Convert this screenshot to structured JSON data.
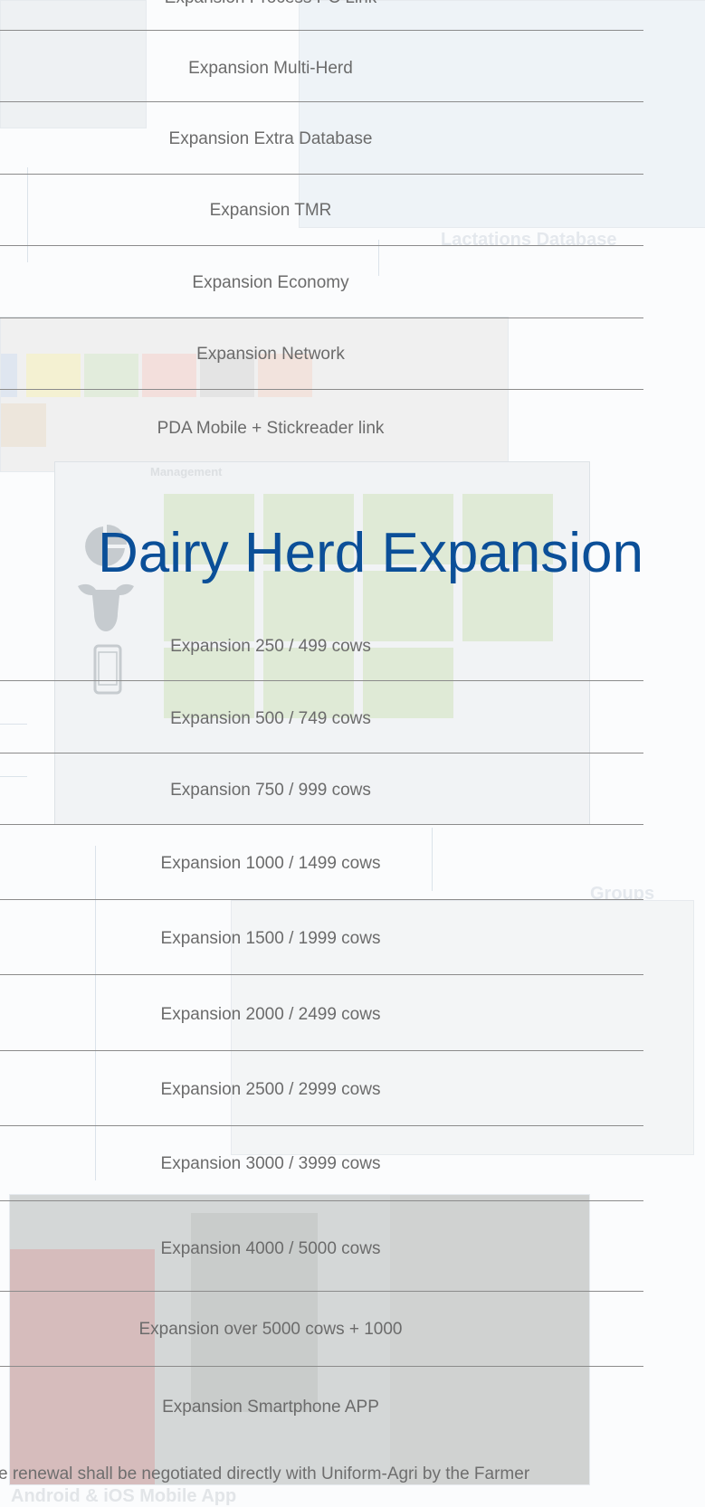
{
  "colors": {
    "accent": "#0b4f98",
    "text": "#6b6b6b",
    "divider": "#8b8b8b"
  },
  "icons": [
    "pie-chart-icon",
    "cow-icon",
    "smartphone-icon"
  ],
  "background_text": {
    "lactations": "Lactations Database",
    "groups": "Groups",
    "mobile": "Android & iOS Mobile App",
    "management": "Management"
  },
  "options_top": [
    "Expansion Process PC Link",
    "Expansion Multi-Herd",
    "Expansion Extra Database",
    "Expansion TMR",
    "Expansion Economy",
    "Expansion Network",
    "PDA Mobile + Stickreader link"
  ],
  "section_title": "Dairy Herd Expansion",
  "herd_options": [
    "Expansion 250 / 499 cows",
    "Expansion 500 / 749 cows",
    "Expansion 750 / 999 cows",
    "Expansion 1000 / 1499 cows",
    "Expansion 1500 / 1999 cows",
    "Expansion 2000 / 2499 cows",
    "Expansion 2500 / 2999 cows",
    "Expansion 3000 / 3999 cows",
    "Expansion 4000 / 5000 cows",
    "Expansion over 5000 cows + 1000",
    "Expansion Smartphone APP"
  ],
  "footnote": "e renewal shall be negotiated directly with Uniform-Agri by the Farmer"
}
